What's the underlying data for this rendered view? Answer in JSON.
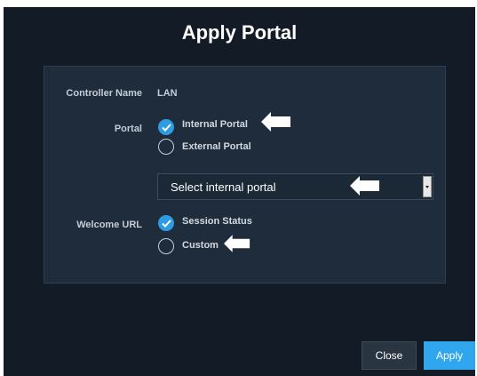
{
  "dialog": {
    "title": "Apply Portal"
  },
  "form": {
    "controller_name": {
      "label": "Controller Name",
      "value": "LAN"
    },
    "portal": {
      "label": "Portal",
      "options": [
        {
          "label": "Internal Portal",
          "checked": true
        },
        {
          "label": "External Portal",
          "checked": false
        }
      ]
    },
    "portal_select": {
      "value": "Select internal portal"
    },
    "welcome_url": {
      "label": "Welcome URL",
      "options": [
        {
          "label": "Session Status",
          "checked": true
        },
        {
          "label": "Custom",
          "checked": false
        }
      ]
    }
  },
  "buttons": {
    "close_label": "Close",
    "apply_label": "Apply"
  },
  "colors": {
    "dialog_bg": "#121b26",
    "panel_bg": "#1e2c3c",
    "accent": "#2f9be0",
    "apply_button": "#2fa6ee"
  },
  "icons": {
    "pointer_arrow": "left-arrow-icon",
    "check": "check-icon"
  }
}
